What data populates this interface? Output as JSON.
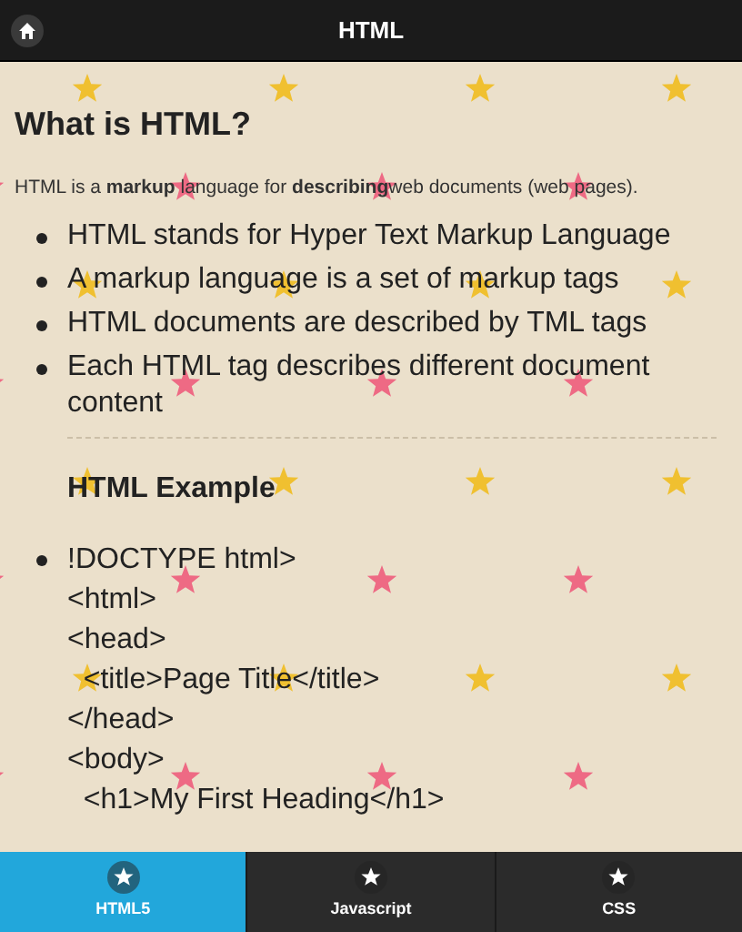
{
  "header": {
    "title": "HTML"
  },
  "content": {
    "heading": "What is HTML?",
    "intro": "HTML is a **markup** language for **describing**web documents (web pages).",
    "bullets": [
      "HTML stands for Hyper Text Markup Language",
      "A markup language is a set of markup tags",
      "HTML documents are described by TML tags",
      "Each HTML tag describes different document content"
    ],
    "example_heading": "HTML Example",
    "example_lines": [
      "!DOCTYPE html>",
      "<html>",
      "<head>",
      "  <title>Page Title</title>",
      "</head>",
      "<body>",
      "  <h1>My First Heading</h1>"
    ]
  },
  "tabs": [
    {
      "label": "HTML5",
      "selected": true
    },
    {
      "label": "Javascript",
      "selected": false
    },
    {
      "label": "CSS",
      "selected": false
    }
  ]
}
